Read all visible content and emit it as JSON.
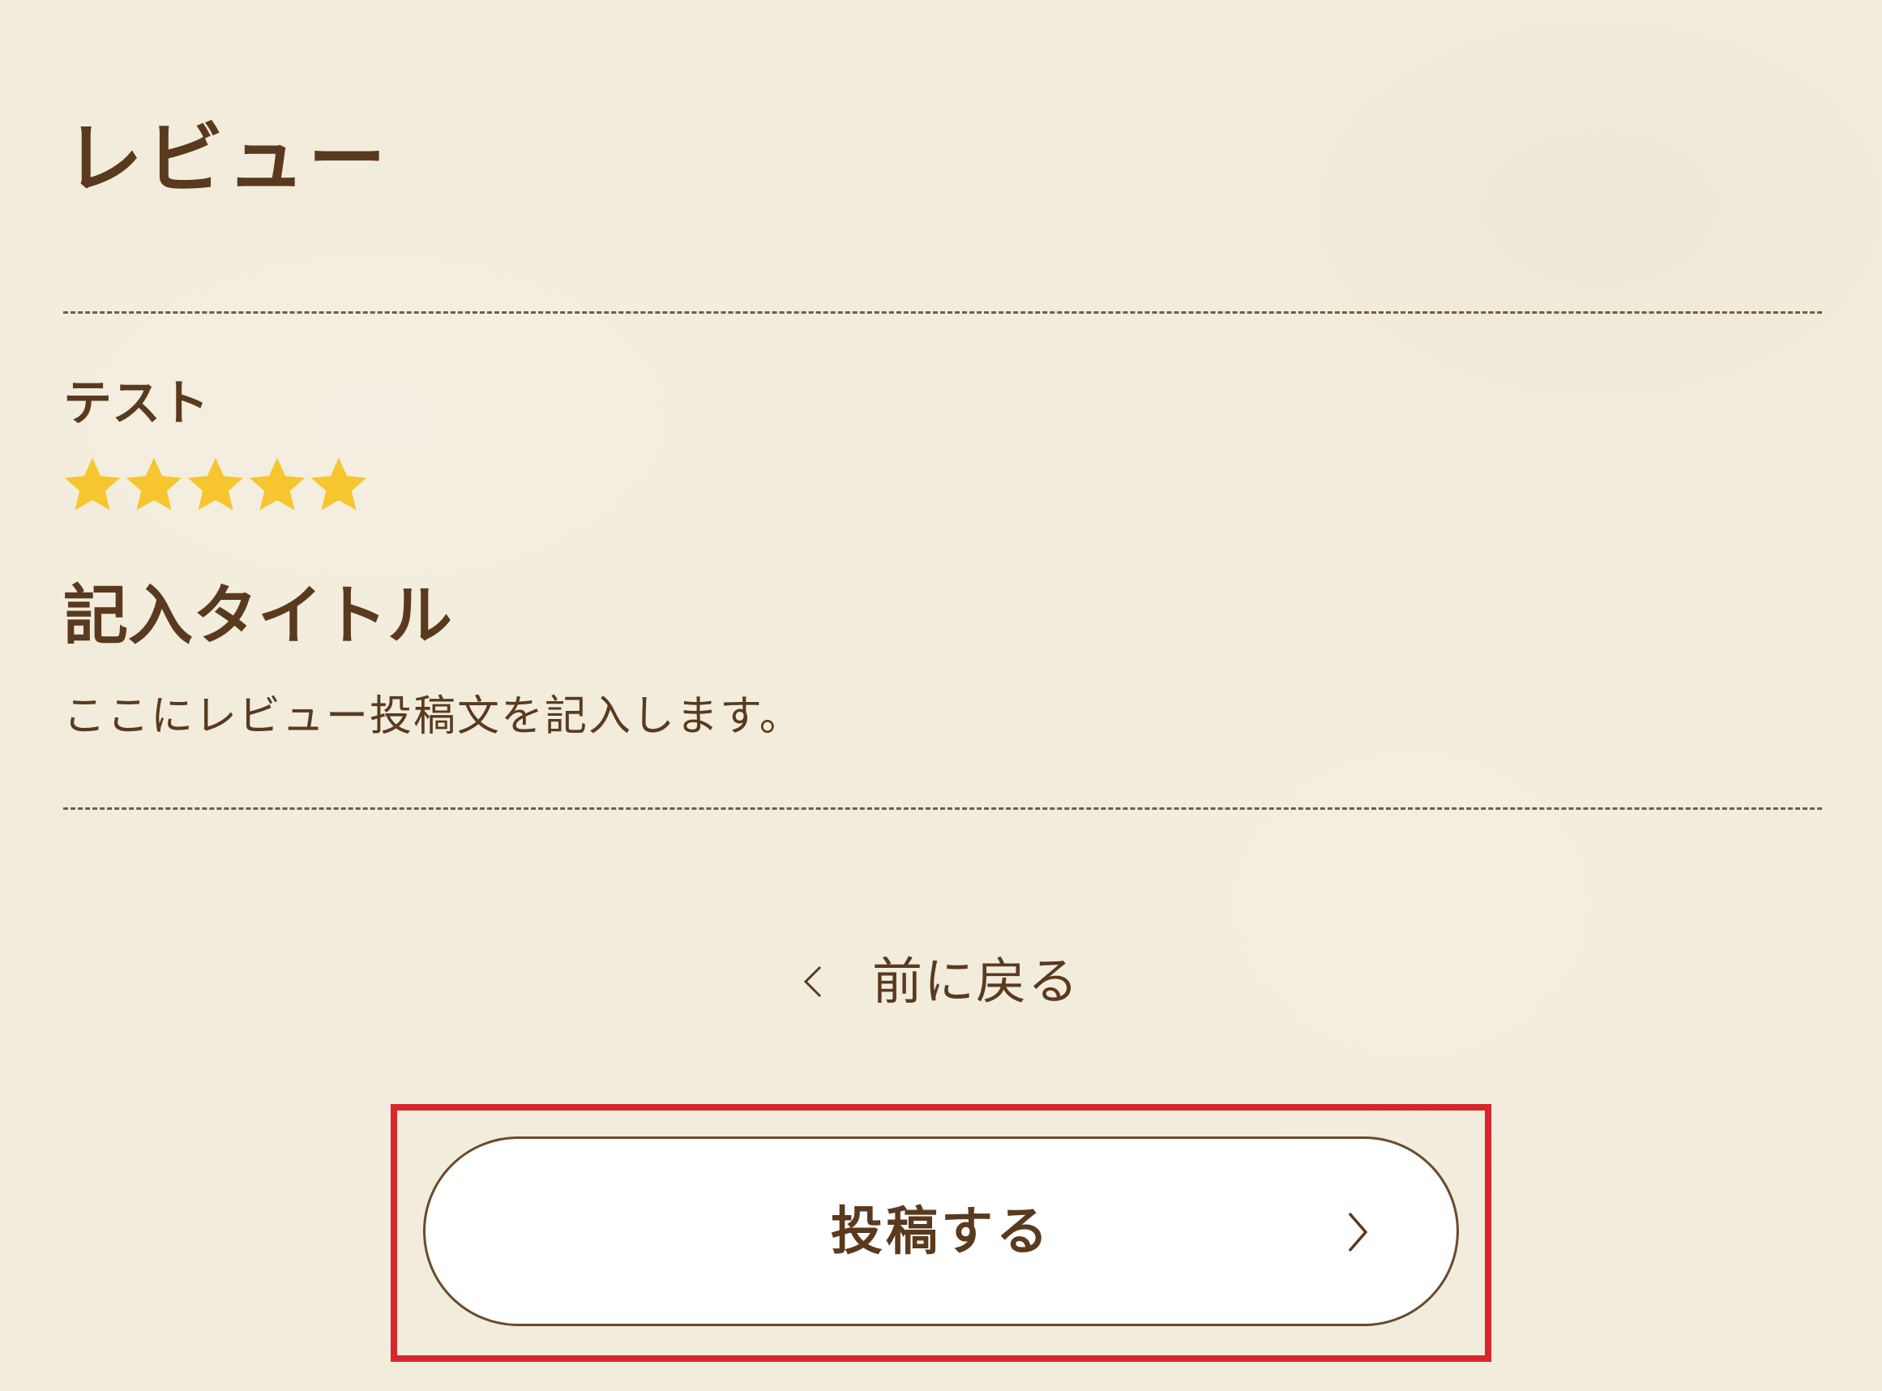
{
  "page": {
    "title": "レビュー"
  },
  "review": {
    "reviewer_name": "テスト",
    "rating": 5,
    "rating_max": 5,
    "star_color": "#f7c62f",
    "title": "記入タイトル",
    "body": "ここにレビュー投稿文を記入します。"
  },
  "actions": {
    "back_label": "前に戻る",
    "back_icon": "chevron-left-icon",
    "submit_label": "投稿する",
    "submit_icon": "chevron-right-icon"
  },
  "colors": {
    "text": "#5a3a1e",
    "background": "#f2ecdc",
    "highlight": "#d8262a"
  }
}
